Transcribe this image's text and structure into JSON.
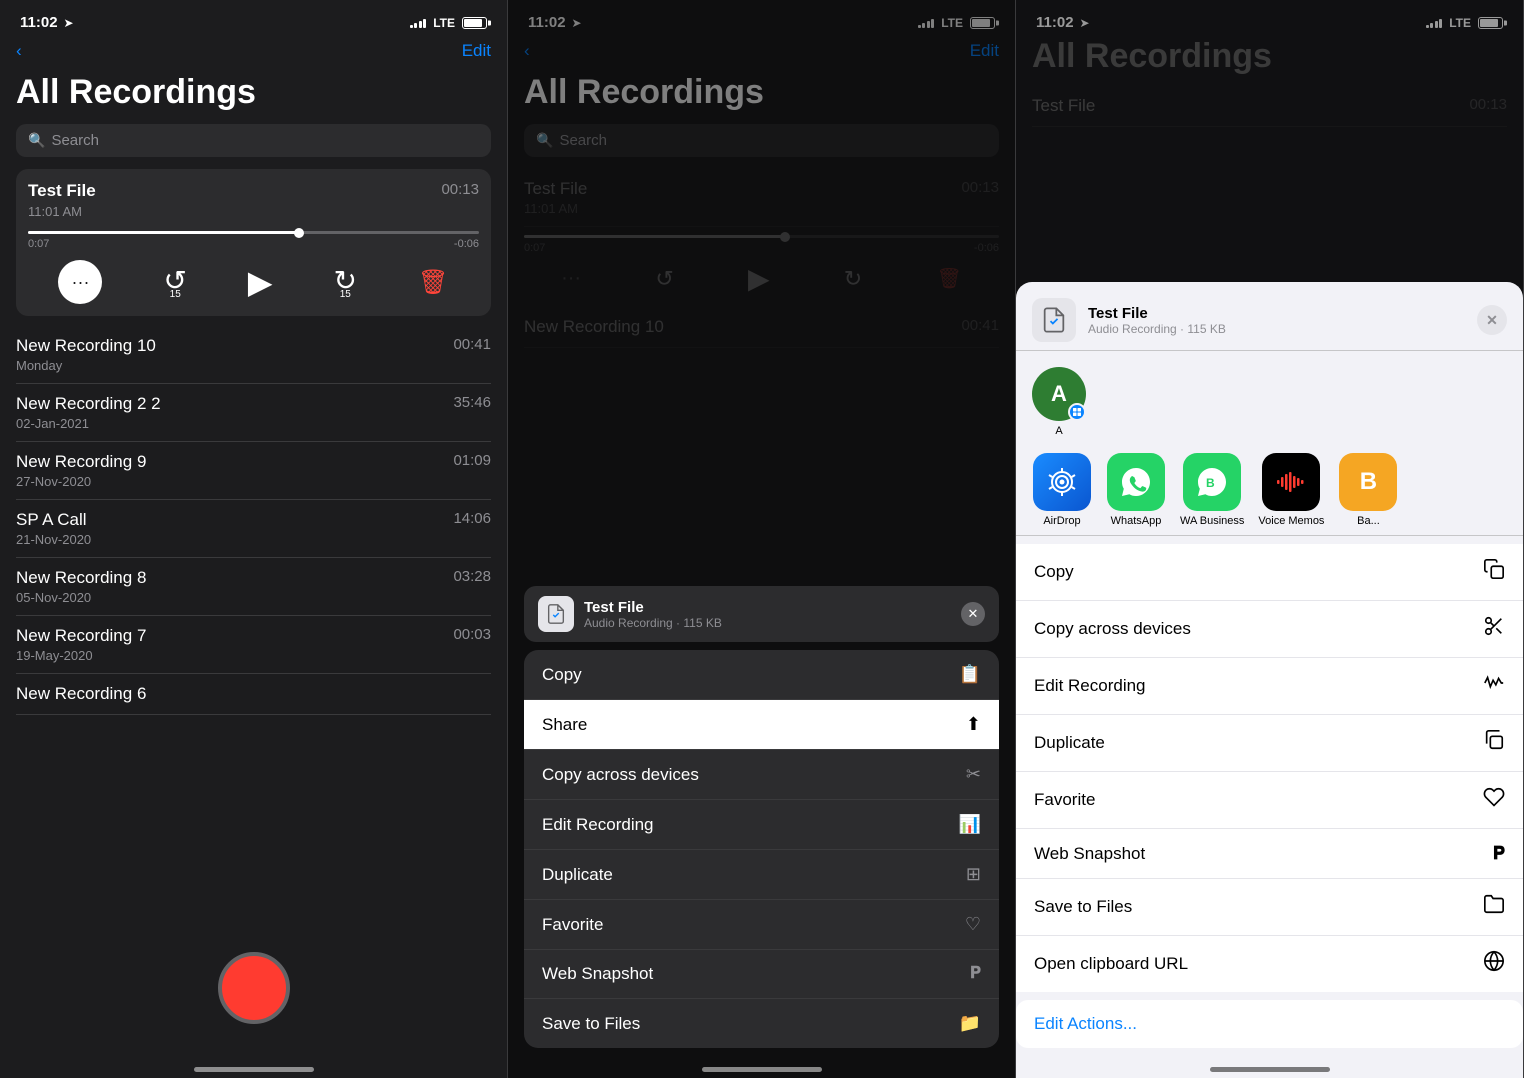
{
  "panels": [
    {
      "id": "panel1",
      "statusBar": {
        "time": "11:02",
        "hasArrow": true,
        "signal": "LTE"
      },
      "nav": {
        "back": "‹",
        "edit": "Edit"
      },
      "title": "All Recordings",
      "search": {
        "placeholder": "Search"
      },
      "recordings": [
        {
          "name": "Test File",
          "date": "11:01 AM",
          "duration": "00:13",
          "expanded": true
        },
        {
          "name": "New Recording 10",
          "date": "Monday",
          "duration": "00:41"
        },
        {
          "name": "New Recording 2 2",
          "date": "02-Jan-2021",
          "duration": "35:46"
        },
        {
          "name": "New Recording 9",
          "date": "27-Nov-2020",
          "duration": "01:09"
        },
        {
          "name": "SP A Call",
          "date": "21-Nov-2020",
          "duration": "14:06"
        },
        {
          "name": "New Recording 8",
          "date": "05-Nov-2020",
          "duration": "03:28"
        },
        {
          "name": "New Recording 7",
          "date": "19-May-2020",
          "duration": "00:03"
        },
        {
          "name": "New Recording 6",
          "date": "",
          "duration": ""
        }
      ],
      "waveform": {
        "progress": "60%",
        "timeLeft": "0:07",
        "timeRight": "-0:06"
      },
      "controls": {
        "more": "···",
        "rewind": "15",
        "play": "▶",
        "forward": "15",
        "delete": "🗑"
      }
    },
    {
      "id": "panel2",
      "statusBar": {
        "time": "11:02",
        "hasArrow": true,
        "signal": "LTE"
      },
      "nav": {
        "back": "‹",
        "edit": "Edit"
      },
      "title": "All Recordings",
      "search": {
        "placeholder": "Search"
      },
      "activeRecording": "New Recording 10",
      "contextMenu": {
        "fileChip": {
          "name": "Test File",
          "meta": "Audio Recording · 115 KB"
        },
        "items": [
          {
            "label": "Copy",
            "icon": "📋"
          },
          {
            "label": "Share",
            "icon": "⬆",
            "active": true
          },
          {
            "label": "Copy across devices",
            "icon": "✂"
          },
          {
            "label": "Edit Recording",
            "icon": "📊"
          },
          {
            "label": "Duplicate",
            "icon": "⊞"
          },
          {
            "label": "Favorite",
            "icon": "♡"
          },
          {
            "label": "Web Snapshot",
            "icon": "𝐏"
          },
          {
            "label": "Save to Files",
            "icon": "📁"
          }
        ]
      }
    },
    {
      "id": "panel3",
      "statusBar": {
        "time": "11:02",
        "hasArrow": true,
        "signal": "LTE"
      },
      "shareSheet": {
        "file": {
          "name": "Test File",
          "meta": "Audio Recording · 115 KB"
        },
        "contact": {
          "initial": "A",
          "name": "A"
        },
        "apps": [
          {
            "id": "airdrop",
            "name": "AirDrop"
          },
          {
            "id": "whatsapp",
            "name": "WhatsApp"
          },
          {
            "id": "wabusiness",
            "name": "WA Business"
          },
          {
            "id": "voicememos",
            "name": "Voice Memos"
          },
          {
            "id": "ba",
            "name": "Ba..."
          }
        ],
        "actions": [
          {
            "label": "Copy",
            "icon": "copy"
          },
          {
            "label": "Copy across devices",
            "icon": "scissors"
          },
          {
            "label": "Edit Recording",
            "icon": "waveform"
          },
          {
            "label": "Duplicate",
            "icon": "duplicate"
          },
          {
            "label": "Favorite",
            "icon": "heart"
          },
          {
            "label": "Web Snapshot",
            "icon": "pocket"
          },
          {
            "label": "Save to Files",
            "icon": "folder"
          },
          {
            "label": "Open clipboard URL",
            "icon": "globe"
          }
        ],
        "editActions": "Edit Actions..."
      }
    }
  ]
}
